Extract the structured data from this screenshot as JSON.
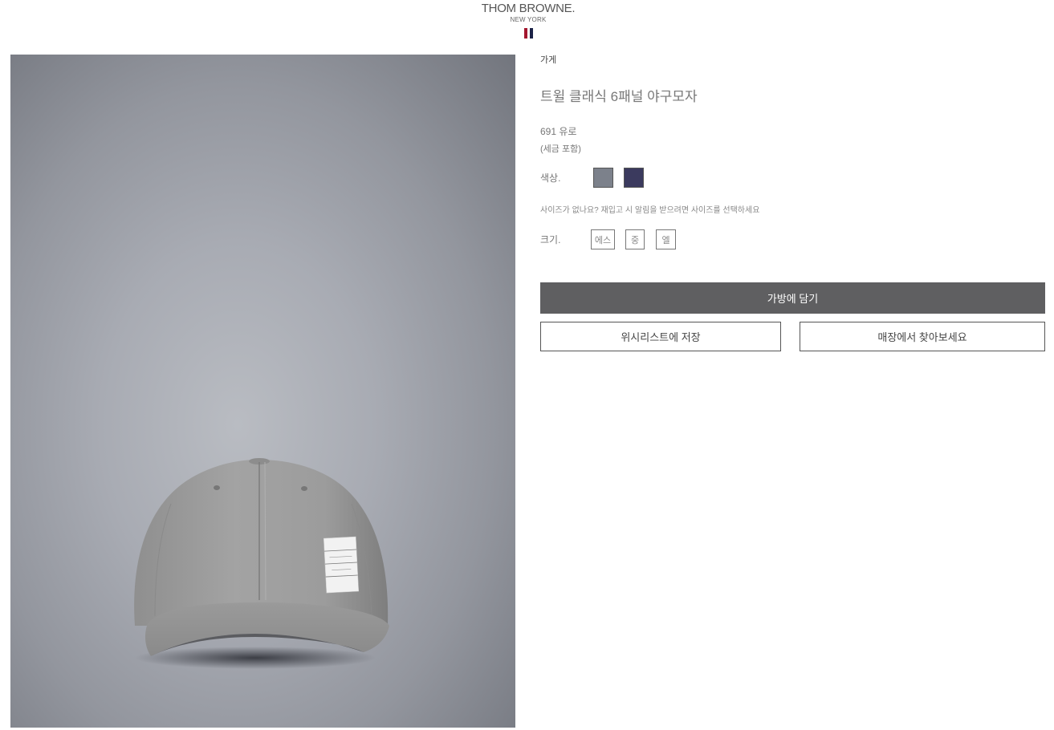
{
  "header": {
    "brand": "THOM BROWNE.",
    "location": "NEW YORK",
    "flag_colors": [
      "#a3172e",
      "#1c2347"
    ]
  },
  "product": {
    "breadcrumb": "가게",
    "title": "트윌 클래식 6패널 야구모자",
    "price": "691 유로",
    "tax_note": "(세금 포함)",
    "color_label": "색상.",
    "colors": [
      {
        "name": "grey",
        "hex": "#7c818b"
      },
      {
        "name": "navy",
        "hex": "#3b3a5e"
      }
    ],
    "size_hint": "사이즈가 없나요? 재입고 시 알림을 받으려면 사이즈를 선택하세요",
    "size_label": "크기.",
    "sizes": [
      "에스",
      "중",
      "엘"
    ],
    "image_alt": "Grey twill baseball cap"
  },
  "actions": {
    "add_to_bag": "가방에 담기",
    "save_wishlist": "위시리스트에 저장",
    "find_in_store": "매장에서 찾아보세요"
  }
}
